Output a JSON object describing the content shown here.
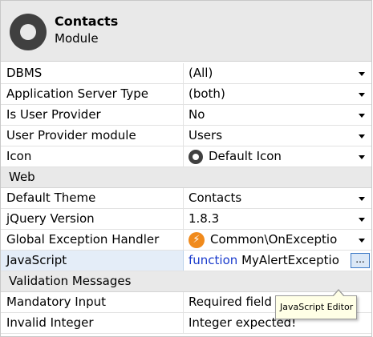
{
  "header": {
    "name": "Contacts",
    "type": "Module",
    "icon": "module-icon"
  },
  "properties": [
    {
      "label": "DBMS",
      "value": "(All)",
      "dropdown": true
    },
    {
      "label": "Application Server Type",
      "value": "(both)",
      "dropdown": true
    },
    {
      "label": "Is User Provider",
      "value": "No",
      "dropdown": true
    },
    {
      "label": "User Provider module",
      "value": "Users",
      "dropdown": true
    },
    {
      "label": "Icon",
      "value": "Default Icon",
      "dropdown": true,
      "icon": "default-circle-icon"
    }
  ],
  "web": {
    "section": "Web",
    "properties": [
      {
        "label": "Default Theme",
        "value": "Contacts",
        "dropdown": true
      },
      {
        "label": "jQuery Version",
        "value": "1.8.3",
        "dropdown": true
      },
      {
        "label": "Global Exception Handler",
        "value": "Common\\OnExceptio",
        "dropdown": true,
        "icon": "lightning-icon"
      },
      {
        "label": "JavaScript",
        "keyword": "function",
        "value": "MyAlertExceptio",
        "button": "..."
      }
    ]
  },
  "validation": {
    "section": "Validation Messages",
    "properties": [
      {
        "label": "Mandatory Input",
        "value": "Required field"
      },
      {
        "label": "Invalid Integer",
        "value": "Integer expected!"
      }
    ]
  },
  "tooltip": "JavaScript Editor",
  "colors": {
    "header_bg": "#e9e9e9",
    "keyword": "#1a3bcc",
    "selected_label": "#e4edf8",
    "bolt_icon": "#f08a1c"
  }
}
